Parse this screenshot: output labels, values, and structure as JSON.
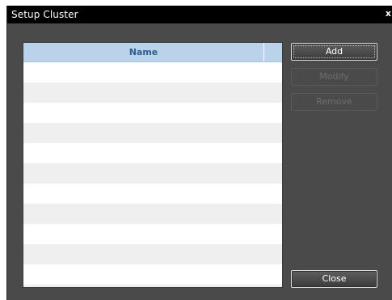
{
  "window": {
    "title": "Setup Cluster",
    "close_glyph": "x"
  },
  "list": {
    "columns": [
      "Name"
    ],
    "rows": []
  },
  "buttons": {
    "add": "Add",
    "modify": "Modify",
    "remove": "Remove",
    "close": "Close"
  },
  "colors": {
    "header_bg": "#bad3ea",
    "header_text": "#2e5f93",
    "dialog_bg": "#4a4a4a",
    "titlebar_bg": "#000000"
  }
}
